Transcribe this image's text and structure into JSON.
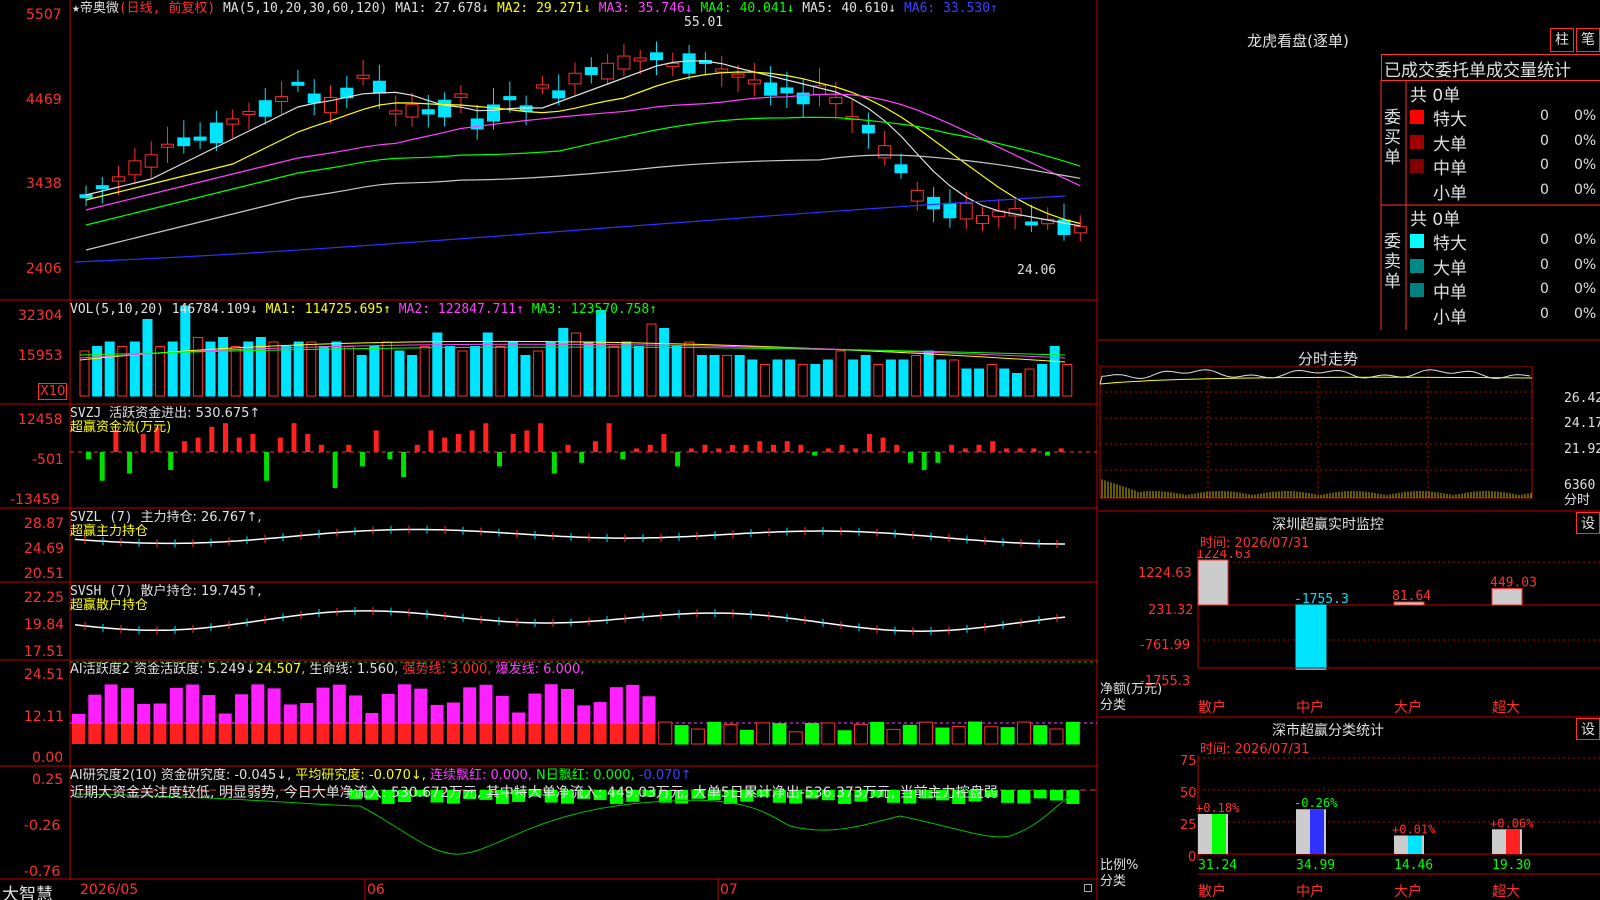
{
  "stock": {
    "name": "帝奥微",
    "mode": "(日线, 前复权)",
    "ma_label": "MA(5,10,20,30,60,120)",
    "ma1": "MA1: 27.678↓",
    "ma2": "MA2: 29.271↓",
    "ma3": "MA3: 35.746↓",
    "ma4": "MA4: 40.041↓",
    "ma5": "MA5: 40.610↓",
    "ma6": "MA6: 33.530↑",
    "high_note": "55.01",
    "low_note": "24.06",
    "price_ticks": [
      "5507",
      "4469",
      "3438",
      "2406"
    ]
  },
  "volume": {
    "label": "VOL(5,10,20)",
    "value": "146784.109↓",
    "ma1": "MA1: 114725.695↑",
    "ma2": "MA2: 122847.711↑",
    "ma3": "MA3: 123570.758↑",
    "ticks": [
      "32304",
      "15953"
    ],
    "unit": "X10",
    "bars": [
      0.5,
      0.55,
      0.6,
      0.55,
      0.6,
      0.85,
      0.55,
      0.6,
      1.0,
      0.65,
      0.6,
      0.65,
      0.55,
      0.6,
      0.65,
      0.6,
      0.55,
      0.6,
      0.6,
      0.55,
      0.6,
      0.55,
      0.45,
      0.55,
      0.6,
      0.5,
      0.45,
      0.55,
      0.7,
      0.55,
      0.5,
      0.55,
      0.7,
      0.55,
      0.6,
      0.45,
      0.5,
      0.6,
      0.75,
      0.7,
      0.6,
      0.95,
      0.55,
      0.6,
      0.55,
      0.8,
      0.75,
      0.55,
      0.6,
      0.45,
      0.45,
      0.45,
      0.45,
      0.4,
      0.35,
      0.4,
      0.4,
      0.35,
      0.35,
      0.4,
      0.5,
      0.4,
      0.45,
      0.35,
      0.4,
      0.4,
      0.45,
      0.5,
      0.4,
      0.4,
      0.3,
      0.3,
      0.35,
      0.3,
      0.25,
      0.3,
      0.35,
      0.55,
      0.35
    ]
  },
  "svzj": {
    "label": "SVZJ",
    "title": "活跃资金进出: 530.675↑",
    "sub": "超赢资金流(万元)",
    "ticks": [
      "12458",
      "-501",
      "-13459"
    ],
    "values": [
      -0.2,
      -0.8,
      0.6,
      -0.6,
      0.5,
      0.7,
      -0.5,
      0.3,
      0.4,
      0.7,
      0.8,
      0.4,
      0.5,
      -0.8,
      0.4,
      0.8,
      0.5,
      0.2,
      -1.0,
      0.2,
      -0.4,
      0.6,
      -0.2,
      -0.7,
      0.2,
      0.6,
      0.4,
      0.5,
      0.6,
      0.8,
      -0.4,
      0.5,
      0.6,
      0.8,
      -0.6,
      0.2,
      -0.3,
      0.3,
      0.8,
      -0.2,
      0.1,
      0.2,
      0.5,
      -0.4,
      0.1,
      0.2,
      0.1,
      0.2,
      0.2,
      0.3,
      0.2,
      0.3,
      0.2,
      -0.1,
      0.1,
      0.2,
      0.1,
      0.5,
      0.4,
      0.2,
      -0.3,
      -0.5,
      -0.3,
      0.2,
      0.1,
      0.2,
      0.3,
      0.1,
      0.1,
      0.1,
      -0.1,
      0.1
    ]
  },
  "svzl": {
    "label": "SVZL (7)",
    "title": "主力持仓: 26.767↑,",
    "sub": "超赢主力持仓",
    "ticks": [
      "28.87",
      "24.69",
      "20.51"
    ]
  },
  "svsh": {
    "label": "SVSH (7)",
    "title": "散户持仓: 19.745↑,",
    "sub": "超赢散户持仓",
    "ticks": [
      "22.25",
      "19.84",
      "17.51"
    ]
  },
  "ai_active": {
    "label": "AI活跃度2",
    "title": "资金活跃度: 5.249↓",
    "v2": "24.507",
    "life": "生命线: 1.560,",
    "strong": "强势线: 3.000,",
    "burst": "爆发线: 6.000,",
    "ticks": [
      "24.51",
      "12.11",
      "0.00"
    ]
  },
  "ai_research": {
    "label": "AI研究度2(10)",
    "title": "资金研究度: -0.045↓,",
    "avg": "平均研究度: -0.070↓,",
    "cont": "连续飘红: 0.000,",
    "nday": "N日飘红: 0.000,",
    "last": "-0.070↑",
    "comment": "近期大资金关注度较低, 明显弱势, 今日大单净流入: 530.672万元, 其中特大单净流入: 449.03万元, 大单5日累计净出-536.373万元, 当前主力控盘弱",
    "ticks": [
      "0.25",
      "-0.26",
      "-0.76"
    ]
  },
  "footer": {
    "brand": "大智慧",
    "dates": [
      "2026/05",
      "06",
      "07"
    ]
  },
  "dragon": {
    "title": "龙虎看盘(逐单)",
    "btn1": "柱",
    "btn2": "笔",
    "header": "已成交委托单成交量统计",
    "buy_side": "委买单",
    "sell_side": "委卖单",
    "buy_total": "共 0单",
    "sell_total": "共 0单",
    "rows": [
      {
        "label": "特大",
        "count": "0",
        "pct": "0%"
      },
      {
        "label": "大单",
        "count": "0",
        "pct": "0%"
      },
      {
        "label": "中单",
        "count": "0",
        "pct": "0%"
      },
      {
        "label": "小单",
        "count": "0",
        "pct": "0%"
      }
    ],
    "sell_rows": [
      {
        "label": "特大",
        "count": "0",
        "pct": "0%"
      },
      {
        "label": "大单",
        "count": "0",
        "pct": "0%"
      },
      {
        "label": "中单",
        "count": "0",
        "pct": "0%"
      },
      {
        "label": "小单",
        "count": "0",
        "pct": "0%"
      }
    ]
  },
  "intraday": {
    "title": "分时走势",
    "ticks": [
      "26.42",
      "24.17",
      "21.92",
      "6360"
    ],
    "unit": "分时"
  },
  "monitor": {
    "title": "深圳超赢实时监控",
    "btn": "设",
    "time": "时间: 2026/07/31",
    "ticks": [
      "1224.63",
      "231.32",
      "-761.99",
      "-1755.3"
    ],
    "ylabel": "净额(万元)",
    "xlabel": "分类",
    "values": [
      "1224.63",
      "-1755.3",
      "81.64",
      "449.03"
    ],
    "cats": [
      "散户",
      "中户",
      "大户",
      "超大"
    ]
  },
  "classify": {
    "title": "深市超赢分类统计",
    "btn": "设",
    "time": "时间: 2026/07/31",
    "ticks": [
      "75",
      "50",
      "25",
      "0"
    ],
    "ylabel": "比例%",
    "xlabel": "分类",
    "changes": [
      "+0.18%",
      "-0.26%",
      "+0.01%",
      "+0.06%"
    ],
    "values": [
      "31.24",
      "34.99",
      "14.46",
      "19.30"
    ],
    "cats": [
      "散户",
      "中户",
      "大户",
      "超大"
    ]
  }
}
